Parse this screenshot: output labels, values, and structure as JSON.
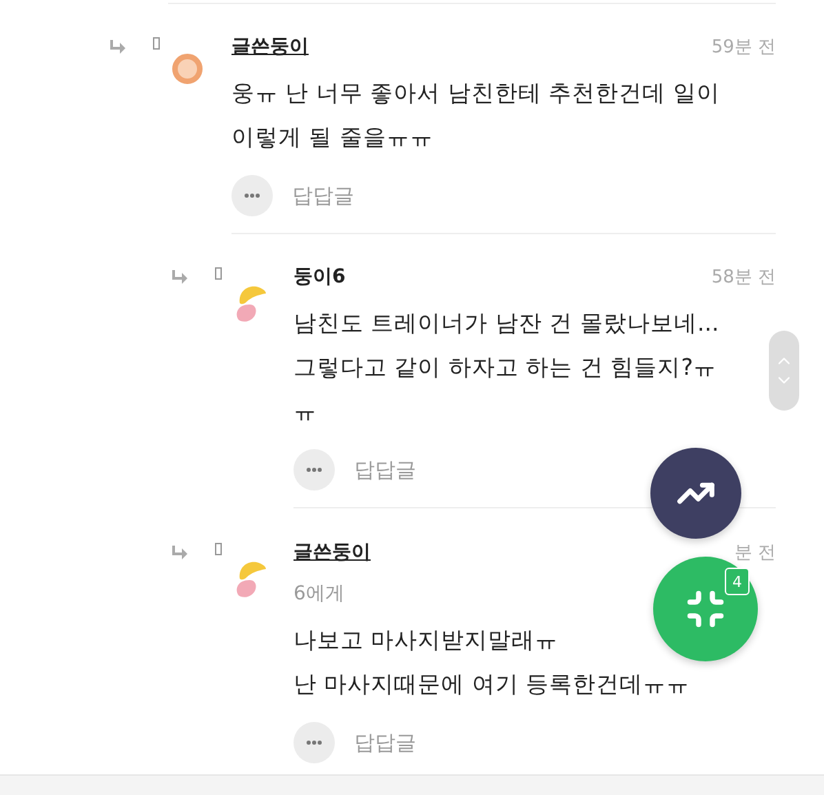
{
  "thread": [
    {
      "author": "글쓴둥이",
      "is_writer": true,
      "avatar": {
        "kind": "ring"
      },
      "time": "59분 전",
      "lines": [
        "웅ㅠ 난 너무 좋아서 남친한테 추천한건데 일이",
        "이렇게 될 줄을ㅠㅠ"
      ],
      "reply_label": "답답글",
      "children": [
        {
          "author": "둥이6",
          "is_writer": false,
          "avatar": {
            "kind": "blob"
          },
          "time": "58분 전",
          "lines": [
            "남친도 트레이너가 남잔 건 몰랐나보네...",
            "그렇다고 같이 하자고 하는 건 힘들지?ㅠ",
            "ㅠ"
          ],
          "reply_label": "답답글"
        },
        {
          "author": "글쓴둥이",
          "is_writer": true,
          "avatar": {
            "kind": "blob"
          },
          "time": "분 전",
          "recipient": "6에게",
          "lines": [
            "나보고 마사지받지말래ㅠ",
            "난 마사지때문에 여기 등록한건데ㅠㅠ"
          ],
          "reply_label": "답답글"
        }
      ]
    }
  ],
  "fab_badge": "4"
}
